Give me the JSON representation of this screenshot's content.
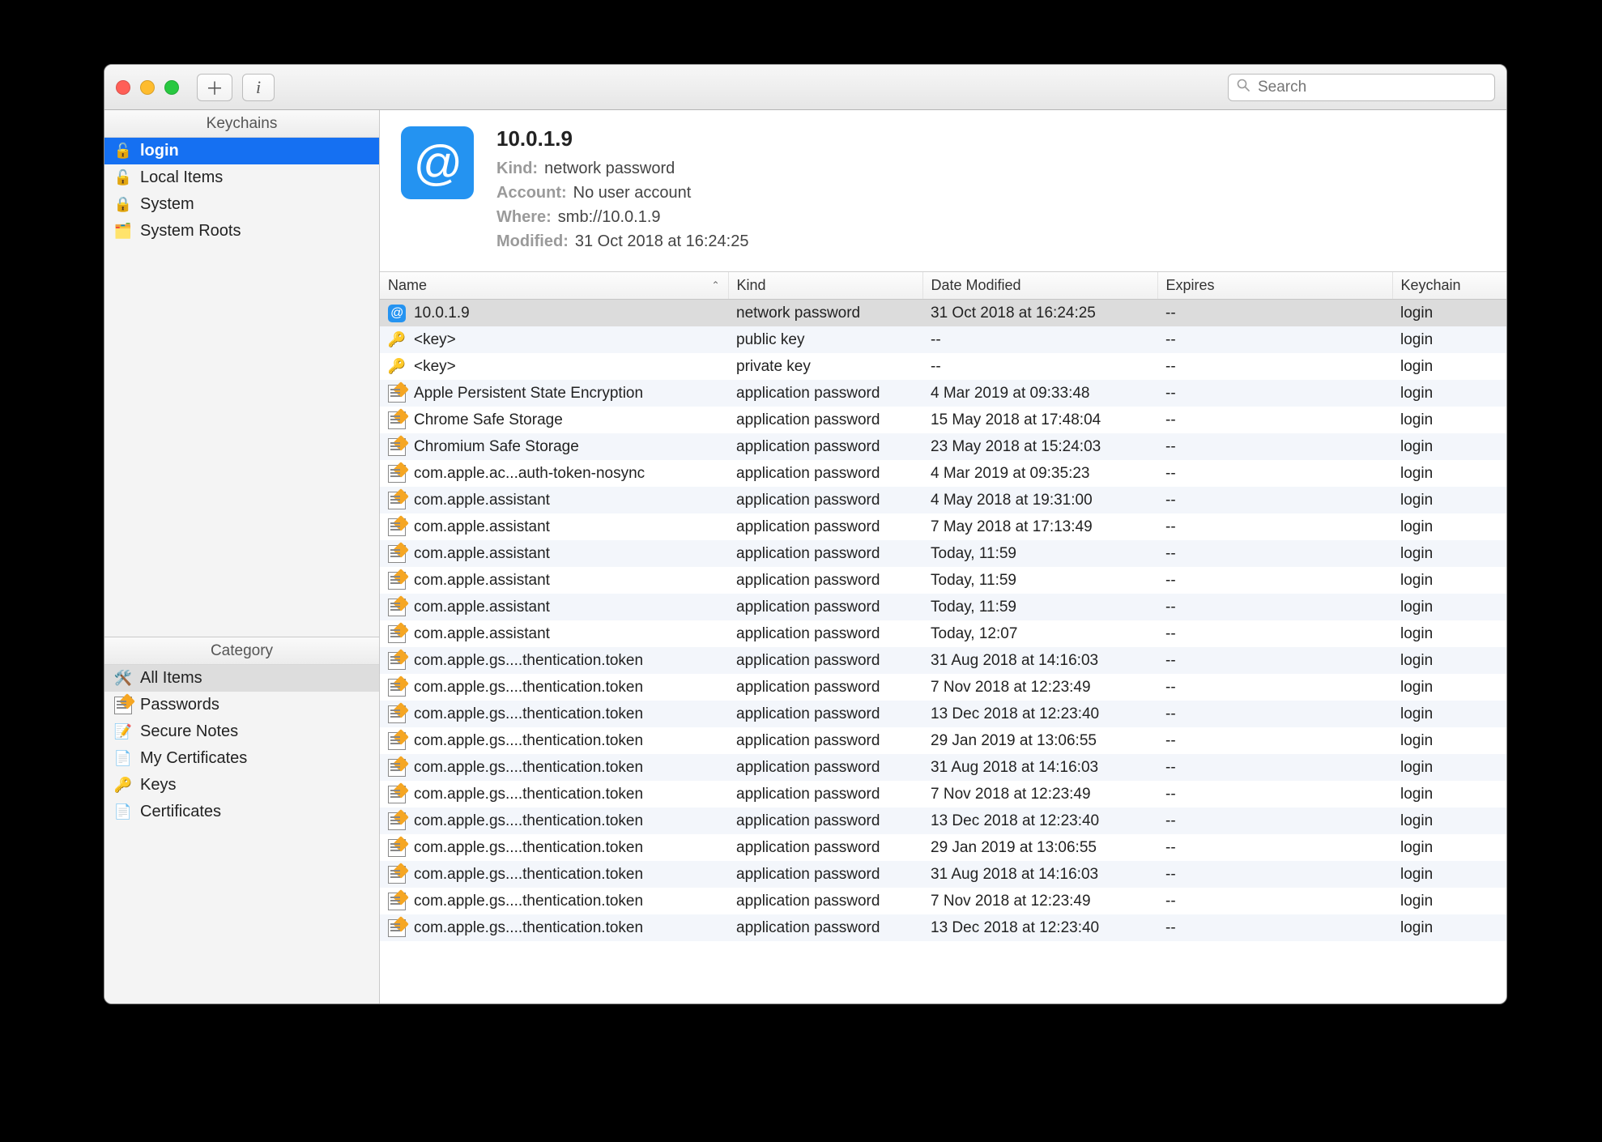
{
  "toolbar": {
    "search_placeholder": "Search"
  },
  "sidebar": {
    "keychains_header": "Keychains",
    "keychains": [
      {
        "icon": "lock-open-icon",
        "label": "login",
        "selected": true
      },
      {
        "icon": "lock-open-icon",
        "label": "Local Items"
      },
      {
        "icon": "lock-icon",
        "label": "System"
      },
      {
        "icon": "roots-icon",
        "label": "System Roots"
      }
    ],
    "category_header": "Category",
    "categories": [
      {
        "icon": "all-items-icon",
        "label": "All Items",
        "selected": true
      },
      {
        "icon": "passwords-icon",
        "label": "Passwords"
      },
      {
        "icon": "secure-notes-icon",
        "label": "Secure Notes"
      },
      {
        "icon": "certificate-icon",
        "label": "My Certificates"
      },
      {
        "icon": "keys-icon",
        "label": "Keys"
      },
      {
        "icon": "certificate-icon",
        "label": "Certificates"
      }
    ]
  },
  "detail": {
    "icon": "at-icon",
    "title": "10.0.1.9",
    "kind_label": "Kind:",
    "kind_value": "network password",
    "account_label": "Account:",
    "account_value": "No user account",
    "where_label": "Where:",
    "where_value": "smb://10.0.1.9",
    "modified_label": "Modified:",
    "modified_value": "31 Oct 2018 at 16:24:25"
  },
  "table": {
    "columns": {
      "name": "Name",
      "kind": "Kind",
      "date": "Date Modified",
      "expires": "Expires",
      "keychain": "Keychain"
    },
    "rows": [
      {
        "icon": "at",
        "name": "10.0.1.9",
        "kind": "network password",
        "date": "31 Oct 2018 at 16:24:25",
        "expires": "--",
        "keychain": "login",
        "selected": true
      },
      {
        "icon": "key",
        "name": "<key>",
        "kind": "public key",
        "date": "--",
        "expires": "--",
        "keychain": "login"
      },
      {
        "icon": "key",
        "name": "<key>",
        "kind": "private key",
        "date": "--",
        "expires": "--",
        "keychain": "login"
      },
      {
        "icon": "note",
        "name": "Apple Persistent State Encryption",
        "kind": "application password",
        "date": "4 Mar 2019 at 09:33:48",
        "expires": "--",
        "keychain": "login"
      },
      {
        "icon": "note",
        "name": "Chrome Safe Storage",
        "kind": "application password",
        "date": "15 May 2018 at 17:48:04",
        "expires": "--",
        "keychain": "login"
      },
      {
        "icon": "note",
        "name": "Chromium Safe Storage",
        "kind": "application password",
        "date": "23 May 2018 at 15:24:03",
        "expires": "--",
        "keychain": "login"
      },
      {
        "icon": "note",
        "name": "com.apple.ac...auth-token-nosync",
        "kind": "application password",
        "date": "4 Mar 2019 at 09:35:23",
        "expires": "--",
        "keychain": "login"
      },
      {
        "icon": "note",
        "name": "com.apple.assistant",
        "kind": "application password",
        "date": "4 May 2018 at 19:31:00",
        "expires": "--",
        "keychain": "login"
      },
      {
        "icon": "note",
        "name": "com.apple.assistant",
        "kind": "application password",
        "date": "7 May 2018 at 17:13:49",
        "expires": "--",
        "keychain": "login"
      },
      {
        "icon": "note",
        "name": "com.apple.assistant",
        "kind": "application password",
        "date": "Today, 11:59",
        "expires": "--",
        "keychain": "login"
      },
      {
        "icon": "note",
        "name": "com.apple.assistant",
        "kind": "application password",
        "date": "Today, 11:59",
        "expires": "--",
        "keychain": "login"
      },
      {
        "icon": "note",
        "name": "com.apple.assistant",
        "kind": "application password",
        "date": "Today, 11:59",
        "expires": "--",
        "keychain": "login"
      },
      {
        "icon": "note",
        "name": "com.apple.assistant",
        "kind": "application password",
        "date": "Today, 12:07",
        "expires": "--",
        "keychain": "login"
      },
      {
        "icon": "note",
        "name": "com.apple.gs....thentication.token",
        "kind": "application password",
        "date": "31 Aug 2018 at 14:16:03",
        "expires": "--",
        "keychain": "login"
      },
      {
        "icon": "note",
        "name": "com.apple.gs....thentication.token",
        "kind": "application password",
        "date": "7 Nov 2018 at 12:23:49",
        "expires": "--",
        "keychain": "login"
      },
      {
        "icon": "note",
        "name": "com.apple.gs....thentication.token",
        "kind": "application password",
        "date": "13 Dec 2018 at 12:23:40",
        "expires": "--",
        "keychain": "login"
      },
      {
        "icon": "note",
        "name": "com.apple.gs....thentication.token",
        "kind": "application password",
        "date": "29 Jan 2019 at 13:06:55",
        "expires": "--",
        "keychain": "login"
      },
      {
        "icon": "note",
        "name": "com.apple.gs....thentication.token",
        "kind": "application password",
        "date": "31 Aug 2018 at 14:16:03",
        "expires": "--",
        "keychain": "login"
      },
      {
        "icon": "note",
        "name": "com.apple.gs....thentication.token",
        "kind": "application password",
        "date": "7 Nov 2018 at 12:23:49",
        "expires": "--",
        "keychain": "login"
      },
      {
        "icon": "note",
        "name": "com.apple.gs....thentication.token",
        "kind": "application password",
        "date": "13 Dec 2018 at 12:23:40",
        "expires": "--",
        "keychain": "login"
      },
      {
        "icon": "note",
        "name": "com.apple.gs....thentication.token",
        "kind": "application password",
        "date": "29 Jan 2019 at 13:06:55",
        "expires": "--",
        "keychain": "login"
      },
      {
        "icon": "note",
        "name": "com.apple.gs....thentication.token",
        "kind": "application password",
        "date": "31 Aug 2018 at 14:16:03",
        "expires": "--",
        "keychain": "login"
      },
      {
        "icon": "note",
        "name": "com.apple.gs....thentication.token",
        "kind": "application password",
        "date": "7 Nov 2018 at 12:23:49",
        "expires": "--",
        "keychain": "login"
      },
      {
        "icon": "note",
        "name": "com.apple.gs....thentication.token",
        "kind": "application password",
        "date": "13 Dec 2018 at 12:23:40",
        "expires": "--",
        "keychain": "login"
      }
    ]
  }
}
